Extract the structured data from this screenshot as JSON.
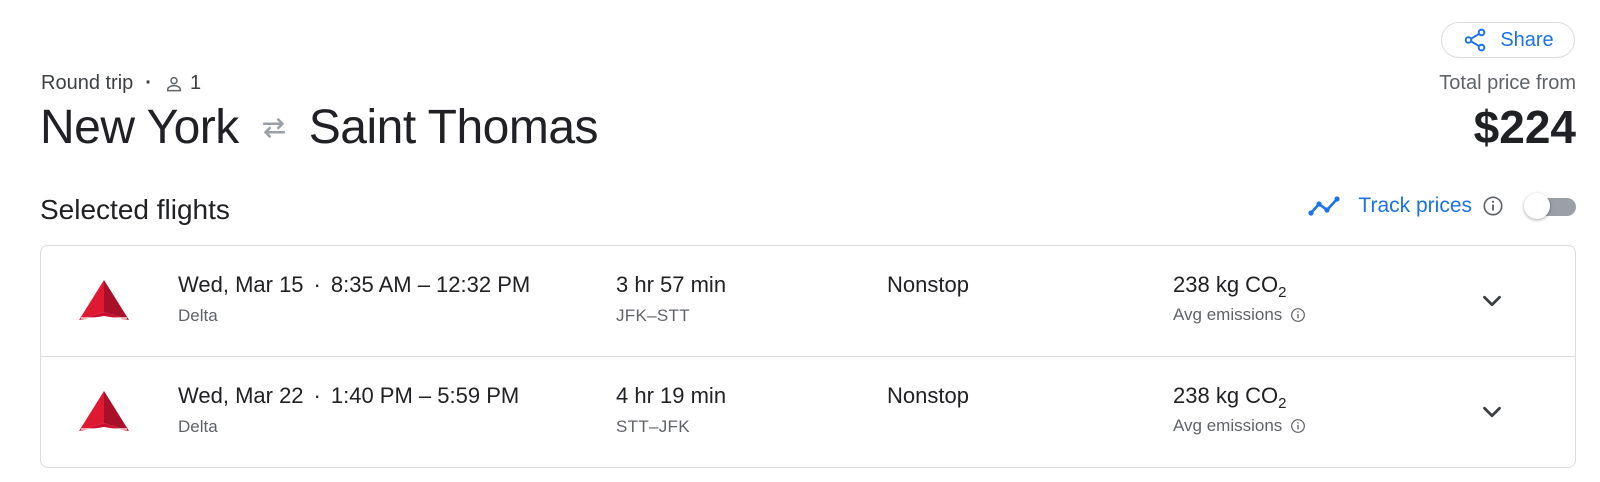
{
  "share": {
    "label": "Share",
    "icon": "share-icon",
    "color": "#1a73e8"
  },
  "trip": {
    "type": "Round trip",
    "separator": "·",
    "passengers": "1",
    "origin": "New York",
    "destination": "Saint Thomas"
  },
  "price": {
    "label": "Total price from",
    "value": "$224"
  },
  "section": {
    "title": "Selected flights"
  },
  "track": {
    "label": "Track prices",
    "toggle_on": false
  },
  "flights": [
    {
      "date": "Wed, Mar 15",
      "sep": "·",
      "times": "8:35 AM – 12:32 PM",
      "airline": "Delta",
      "duration": "3 hr 57 min",
      "airports": "JFK–STT",
      "stops": "Nonstop",
      "emissions_value": "238 kg CO",
      "emissions_sub": "2",
      "emissions_label": "Avg emissions"
    },
    {
      "date": "Wed, Mar 22",
      "sep": "·",
      "times": "1:40 PM – 5:59 PM",
      "airline": "Delta",
      "duration": "4 hr 19 min",
      "airports": "STT–JFK",
      "stops": "Nonstop",
      "emissions_value": "238 kg CO",
      "emissions_sub": "2",
      "emissions_label": "Avg emissions"
    }
  ],
  "colors": {
    "accent": "#1a73e8",
    "delta_red": "#e01933",
    "text": "#202124",
    "muted": "#5f6368"
  }
}
